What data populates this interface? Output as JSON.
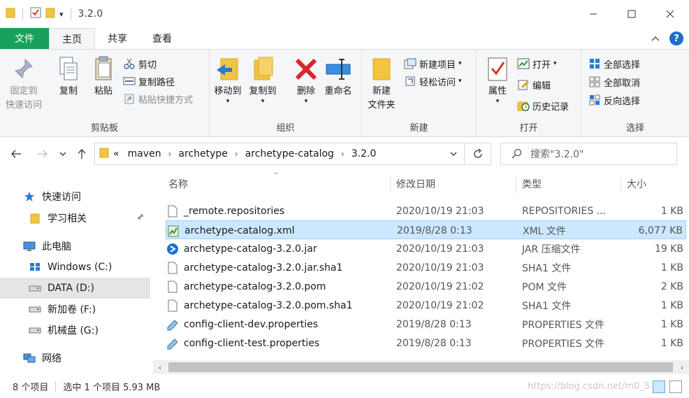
{
  "window": {
    "title": "3.2.0",
    "qat_customize": "▾"
  },
  "tabs": [
    {
      "label": "文件"
    },
    {
      "label": "主页"
    },
    {
      "label": "共享"
    },
    {
      "label": "查看"
    }
  ],
  "ribbon": {
    "clipboard": {
      "label": "剪贴板",
      "pin_label_1": "固定到",
      "pin_label_2": "快速访问",
      "copy": "复制",
      "paste": "粘贴",
      "cut": "剪切",
      "copy_path": "复制路径",
      "paste_shortcut": "粘贴快捷方式"
    },
    "organize": {
      "label": "组织",
      "move_to": "移动到",
      "copy_to": "复制到",
      "delete": "删除",
      "rename": "重命名"
    },
    "new": {
      "label": "新建",
      "new_folder_1": "新建",
      "new_folder_2": "文件夹",
      "new_item": "新建项目",
      "easy_access": "轻松访问"
    },
    "open": {
      "label": "打开",
      "properties": "属性",
      "open": "打开",
      "edit": "编辑",
      "history": "历史记录"
    },
    "select": {
      "label": "选择",
      "select_all": "全部选择",
      "select_none": "全部取消",
      "invert": "反向选择"
    }
  },
  "address": {
    "overflow": "«",
    "crumbs": [
      "maven",
      "archetype",
      "archetype-catalog",
      "3.2.0"
    ],
    "search_placeholder": "搜索\"3.2.0\""
  },
  "navpane": {
    "items": [
      {
        "label": "快速访问"
      },
      {
        "label": "学习相关"
      },
      {
        "label": "此电脑"
      },
      {
        "label": "Windows (C:)"
      },
      {
        "label": "DATA (D:)"
      },
      {
        "label": "新加卷 (F:)"
      },
      {
        "label": "机械盘 (G:)"
      },
      {
        "label": "网络"
      }
    ]
  },
  "columns": {
    "name": "名称",
    "date": "修改日期",
    "type": "类型",
    "size": "大小"
  },
  "files": [
    {
      "name": "_remote.repositories",
      "date": "2020/10/19 21:03",
      "type": "REPOSITORIES ...",
      "size": "1 KB"
    },
    {
      "name": "archetype-catalog.xml",
      "date": "2019/8/28 0:13",
      "type": "XML 文件",
      "size": "6,077 KB"
    },
    {
      "name": "archetype-catalog-3.2.0.jar",
      "date": "2020/10/19 21:03",
      "type": "JAR 压缩文件",
      "size": "19 KB"
    },
    {
      "name": "archetype-catalog-3.2.0.jar.sha1",
      "date": "2020/10/19 21:03",
      "type": "SHA1 文件",
      "size": "1 KB"
    },
    {
      "name": "archetype-catalog-3.2.0.pom",
      "date": "2020/10/19 21:02",
      "type": "POM 文件",
      "size": "2 KB"
    },
    {
      "name": "archetype-catalog-3.2.0.pom.sha1",
      "date": "2020/10/19 21:02",
      "type": "SHA1 文件",
      "size": "1 KB"
    },
    {
      "name": "config-client-dev.properties",
      "date": "2019/8/28 0:13",
      "type": "PROPERTIES 文件",
      "size": "1 KB"
    },
    {
      "name": "config-client-test.properties",
      "date": "2019/8/28 0:13",
      "type": "PROPERTIES 文件",
      "size": "1 KB"
    }
  ],
  "status": {
    "count": "8 个项目",
    "selection": "选中 1 个项目  5.93 MB",
    "watermark": "https://blog.csdn.net/m0_5"
  },
  "colors": {
    "file_tab": "#19a15a",
    "selection": "#cce8ff",
    "folder": "#f3c342"
  }
}
